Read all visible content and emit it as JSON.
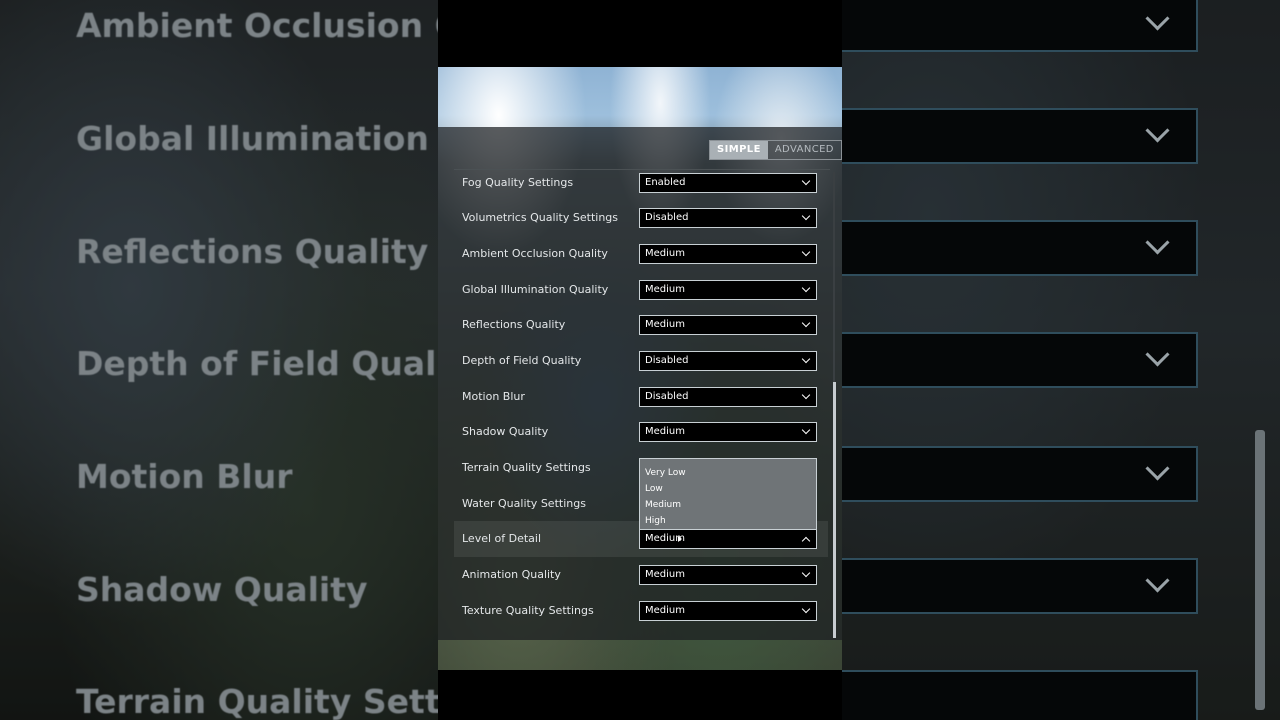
{
  "background_zoom": {
    "labels": [
      "Ambient Occlusion Quality",
      "Global Illumination Quality",
      "Reflections Quality",
      "Depth of Field Quality",
      "Motion Blur",
      "Shadow Quality",
      "Terrain Quality Settings"
    ]
  },
  "mode_toggle": {
    "simple": "SIMPLE",
    "advanced": "ADVANCED",
    "active": "SIMPLE"
  },
  "settings": [
    {
      "label": "Fog Quality Settings",
      "value": "Enabled"
    },
    {
      "label": "Volumetrics Quality Settings",
      "value": "Disabled"
    },
    {
      "label": "Ambient Occlusion Quality",
      "value": "Medium"
    },
    {
      "label": "Global Illumination Quality",
      "value": "Medium"
    },
    {
      "label": "Reflections Quality",
      "value": "Medium"
    },
    {
      "label": "Depth of Field Quality",
      "value": "Disabled"
    },
    {
      "label": "Motion Blur",
      "value": "Disabled"
    },
    {
      "label": "Shadow Quality",
      "value": "Medium"
    },
    {
      "label": "Terrain Quality Settings",
      "value": ""
    },
    {
      "label": "Water Quality Settings",
      "value": ""
    },
    {
      "label": "Level of Detail",
      "value": "Medium"
    },
    {
      "label": "Animation Quality",
      "value": "Medium"
    },
    {
      "label": "Texture Quality Settings",
      "value": "Medium"
    }
  ],
  "open_dropdown": {
    "for": "Level of Detail",
    "options": [
      "Very Low",
      "Low",
      "Medium",
      "High"
    ]
  },
  "colors": {
    "select_border": "#c8d0d4",
    "panel_overlay": "#1c1f21",
    "background": "#000000"
  },
  "icons": [
    "chevron-down-icon",
    "chevron-up-icon",
    "mouse-cursor-icon"
  ]
}
